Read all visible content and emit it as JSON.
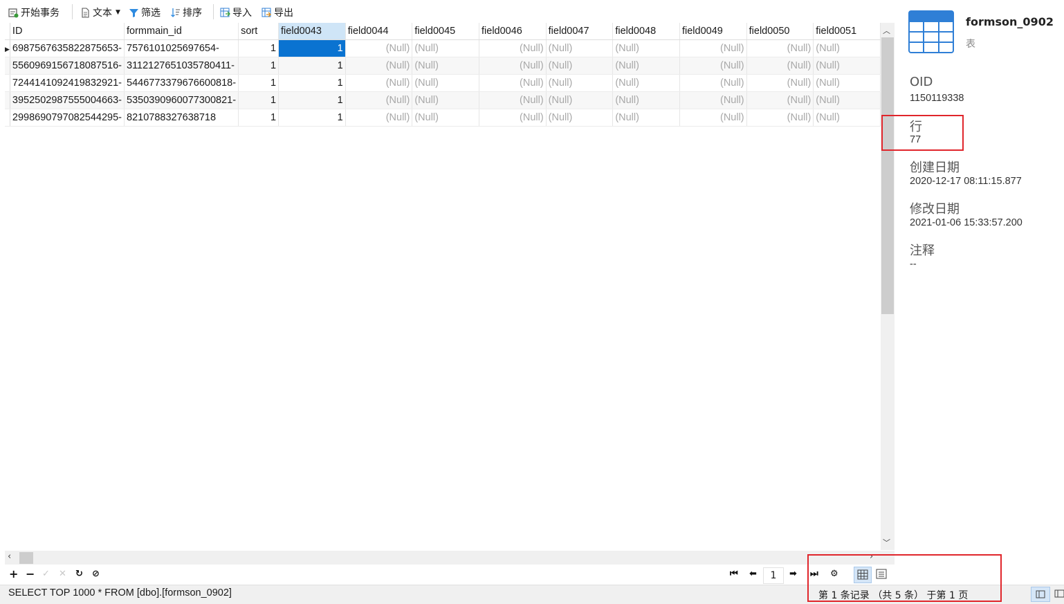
{
  "toolbar": {
    "begin_transaction": "开始事务",
    "text": "文本",
    "filter": "筛选",
    "sort": "排序",
    "import": "导入",
    "export": "导出"
  },
  "grid": {
    "columns": [
      "ID",
      "formmain_id",
      "sort",
      "field0043",
      "field0044",
      "field0045",
      "field0046",
      "field0047",
      "field0048",
      "field0049",
      "field0050",
      "field0051"
    ],
    "rows": [
      [
        "-6987567635822875653",
        "-7576101025697654",
        "1",
        "1",
        "(Null)",
        "(Null)",
        "(Null)",
        "(Null)",
        "(Null)",
        "(Null)",
        "(Null)",
        "(Null)"
      ],
      [
        "-5560969156718087516",
        "-3112127651035780411",
        "1",
        "1",
        "(Null)",
        "(Null)",
        "(Null)",
        "(Null)",
        "(Null)",
        "(Null)",
        "(Null)",
        "(Null)"
      ],
      [
        "-7244141092419832921",
        "-5446773379676600818",
        "1",
        "1",
        "(Null)",
        "(Null)",
        "(Null)",
        "(Null)",
        "(Null)",
        "(Null)",
        "(Null)",
        "(Null)"
      ],
      [
        "-3952502987555004663",
        "-5350390960077300821",
        "1",
        "1",
        "(Null)",
        "(Null)",
        "(Null)",
        "(Null)",
        "(Null)",
        "(Null)",
        "(Null)",
        "(Null)"
      ],
      [
        "-2998690797082544295",
        "8210788327638718",
        "1",
        "1",
        "(Null)",
        "(Null)",
        "(Null)",
        "(Null)",
        "(Null)",
        "(Null)",
        "(Null)",
        "(Null)"
      ]
    ],
    "selected_column": "field0043"
  },
  "pager": {
    "page": "1"
  },
  "status": {
    "sql": "SELECT TOP 1000 * FROM [dbo].[formson_0902]",
    "record_info": "第 1 条记录 （共 5 条） 于第 1 页"
  },
  "side": {
    "table_name": "formson_0902",
    "table_type": "表",
    "oid_label": "OID",
    "oid_value": "1150119338",
    "rows_label": "行",
    "rows_value": "77",
    "created_label": "创建日期",
    "created_value": "2020-12-17 08:11:15.877",
    "modified_label": "修改日期",
    "modified_value": "2021-01-06 15:33:57.200",
    "comment_label": "注释",
    "comment_value": "--"
  },
  "colors": {
    "selected_cell": "#0a73d1",
    "highlight_box": "#e0252b",
    "table_icon": "#2f7fd6"
  }
}
